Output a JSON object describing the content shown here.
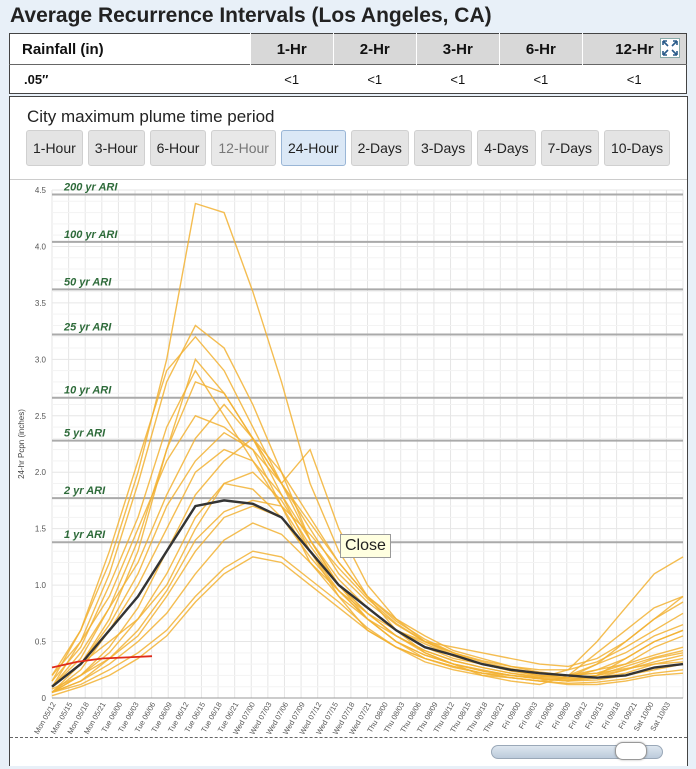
{
  "page_title": "Average Recurrence Intervals (Los Angeles, CA)",
  "ari_table": {
    "headers": [
      "Rainfall (in)",
      "1-Hr",
      "2-Hr",
      "3-Hr",
      "6-Hr",
      "12-Hr"
    ],
    "row": [
      ".05″",
      "<1",
      "<1",
      "<1",
      "<1",
      "<1"
    ],
    "expand_icon": "expand-arrows-icon"
  },
  "panel": {
    "title": "City maximum plume time period",
    "buttons": [
      {
        "label": "1-Hour",
        "state": "normal"
      },
      {
        "label": "3-Hour",
        "state": "normal"
      },
      {
        "label": "6-Hour",
        "state": "normal"
      },
      {
        "label": "12-Hour",
        "state": "disabled"
      },
      {
        "label": "24-Hour",
        "state": "active"
      },
      {
        "label": "2-Days",
        "state": "normal"
      },
      {
        "label": "3-Days",
        "state": "normal"
      },
      {
        "label": "4-Days",
        "state": "normal"
      },
      {
        "label": "7-Days",
        "state": "normal"
      },
      {
        "label": "10-Days",
        "state": "normal"
      }
    ],
    "tooltip": "Close"
  },
  "colors": {
    "ensemble": "#f2b233",
    "mean": "#333333",
    "observed": "#e02a1a",
    "ari_line": "#aaaaaa",
    "ari_label": "#2e6b3a",
    "active_button": "#dbe8f6"
  },
  "chart_data": {
    "type": "line",
    "ylabel": "24-hr Pcpn (inches)",
    "ylim": [
      0,
      4.5
    ],
    "yticks": [
      "0",
      "0.5",
      "1.0",
      "1.5",
      "2.0",
      "2.5",
      "3.0",
      "3.5",
      "4.0",
      "4.5"
    ],
    "x_ticks": [
      "Mon 05/12",
      "Mon 05/15",
      "Mon 05/18",
      "Mon 05/21",
      "Tue 06/00",
      "Tue 06/03",
      "Tue 06/06",
      "Tue 06/09",
      "Tue 06/12",
      "Tue 06/15",
      "Tue 06/18",
      "Tue 06/21",
      "Wed 07/00",
      "Wed 07/03",
      "Wed 07/06",
      "Wed 07/09",
      "Wed 07/12",
      "Wed 07/15",
      "Wed 07/18",
      "Wed 07/21",
      "Thu 08/00",
      "Thu 08/03",
      "Thu 08/06",
      "Thu 08/09",
      "Thu 08/12",
      "Thu 08/15",
      "Thu 08/18",
      "Thu 08/21",
      "Fri 09/00",
      "Fri 09/03",
      "Fri 09/06",
      "Fri 09/09",
      "Fri 09/12",
      "Fri 09/15",
      "Fri 09/18",
      "Fri 09/21",
      "Sat 10/00",
      "Sat 10/03"
    ],
    "ari_thresholds": [
      {
        "label": "200 yr ARI",
        "value": 4.46
      },
      {
        "label": "100 yr ARI",
        "value": 4.04
      },
      {
        "label": "50 yr ARI",
        "value": 3.62
      },
      {
        "label": "25 yr ARI",
        "value": 3.22
      },
      {
        "label": "10 yr ARI",
        "value": 2.66
      },
      {
        "label": "5 yr ARI",
        "value": 2.28
      },
      {
        "label": "2 yr ARI",
        "value": 1.77
      },
      {
        "label": "1 yr ARI",
        "value": 1.38
      }
    ],
    "series": [
      {
        "name": "",
        "role": "mean",
        "values": [
          0.1,
          0.3,
          0.6,
          0.9,
          1.3,
          1.7,
          1.75,
          1.72,
          1.6,
          1.3,
          1.0,
          0.8,
          0.6,
          0.45,
          0.38,
          0.3,
          0.25,
          0.22,
          0.2,
          0.18,
          0.2,
          0.27,
          0.3
        ]
      },
      {
        "name": "",
        "role": "observed",
        "values": [
          0.27,
          0.32,
          0.35,
          0.36,
          0.37
        ]
      },
      {
        "name": "",
        "role": "member",
        "values": [
          0.15,
          0.6,
          1.2,
          2.0,
          3.0,
          4.38,
          4.3,
          3.6,
          2.8,
          1.9,
          1.3,
          0.9,
          0.6,
          0.4,
          0.3,
          0.2,
          0.15,
          0.12,
          0.2,
          0.4,
          0.6,
          0.8,
          0.9
        ]
      },
      {
        "name": "",
        "role": "member",
        "values": [
          0.1,
          0.5,
          1.1,
          1.9,
          2.8,
          3.3,
          3.1,
          2.6,
          2.0,
          1.4,
          1.0,
          0.7,
          0.5,
          0.35,
          0.28,
          0.22,
          0.2,
          0.18,
          0.25,
          0.5,
          0.8,
          1.1,
          1.25
        ]
      },
      {
        "name": "",
        "role": "member",
        "values": [
          0.05,
          0.3,
          0.7,
          1.3,
          2.2,
          3.0,
          2.7,
          2.3,
          1.8,
          1.3,
          0.9,
          0.6,
          0.45,
          0.32,
          0.25,
          0.2,
          0.18,
          0.15,
          0.18,
          0.3,
          0.5,
          0.7,
          0.85
        ]
      },
      {
        "name": "",
        "role": "member",
        "values": [
          0.2,
          0.5,
          0.9,
          1.5,
          2.1,
          2.5,
          2.4,
          2.2,
          1.7,
          1.2,
          0.9,
          0.7,
          0.55,
          0.4,
          0.3,
          0.24,
          0.2,
          0.17,
          0.15,
          0.2,
          0.35,
          0.5,
          0.6
        ]
      },
      {
        "name": "",
        "role": "member",
        "values": [
          0.1,
          0.35,
          0.8,
          1.2,
          1.8,
          2.3,
          2.6,
          2.3,
          1.9,
          1.5,
          1.1,
          0.85,
          0.65,
          0.5,
          0.4,
          0.3,
          0.25,
          0.2,
          0.2,
          0.25,
          0.3,
          0.45,
          0.55
        ]
      },
      {
        "name": "",
        "role": "member",
        "values": [
          0.05,
          0.25,
          0.6,
          1.0,
          1.5,
          2.0,
          2.2,
          2.1,
          1.8,
          1.4,
          1.05,
          0.8,
          0.6,
          0.45,
          0.35,
          0.3,
          0.25,
          0.22,
          0.2,
          0.3,
          0.4,
          0.55,
          0.65
        ]
      },
      {
        "name": "",
        "role": "member",
        "values": [
          0.05,
          0.2,
          0.45,
          0.8,
          1.3,
          1.8,
          2.1,
          2.3,
          2.0,
          1.6,
          1.2,
          0.9,
          0.7,
          0.55,
          0.42,
          0.35,
          0.28,
          0.23,
          0.2,
          0.22,
          0.3,
          0.38,
          0.45
        ]
      },
      {
        "name": "",
        "role": "member",
        "values": [
          0.1,
          0.3,
          0.5,
          0.7,
          1.0,
          1.5,
          1.9,
          2.0,
          1.75,
          1.35,
          1.0,
          0.8,
          0.6,
          0.48,
          0.37,
          0.3,
          0.24,
          0.2,
          0.18,
          0.2,
          0.25,
          0.35,
          0.4
        ]
      },
      {
        "name": "",
        "role": "member",
        "values": [
          0.08,
          0.2,
          0.35,
          0.55,
          0.9,
          1.3,
          1.6,
          1.7,
          1.6,
          1.3,
          1.0,
          0.75,
          0.55,
          0.42,
          0.33,
          0.27,
          0.22,
          0.19,
          0.17,
          0.18,
          0.22,
          0.3,
          0.35
        ]
      },
      {
        "name": "",
        "role": "member",
        "values": [
          0.05,
          0.15,
          0.3,
          0.5,
          0.75,
          1.1,
          1.4,
          1.55,
          1.45,
          1.2,
          0.95,
          0.7,
          0.5,
          0.38,
          0.3,
          0.25,
          0.2,
          0.17,
          0.15,
          0.16,
          0.2,
          0.25,
          0.3
        ]
      },
      {
        "name": "",
        "role": "member",
        "values": [
          0.05,
          0.12,
          0.25,
          0.4,
          0.6,
          0.9,
          1.15,
          1.3,
          1.25,
          1.05,
          0.85,
          0.62,
          0.45,
          0.35,
          0.27,
          0.22,
          0.18,
          0.15,
          0.13,
          0.14,
          0.17,
          0.22,
          0.25
        ]
      },
      {
        "name": "",
        "role": "member",
        "values": [
          0.15,
          0.45,
          1.0,
          1.6,
          2.4,
          2.9,
          2.5,
          2.1,
          1.7,
          1.3,
          0.95,
          0.7,
          0.5,
          0.38,
          0.3,
          0.24,
          0.2,
          0.17,
          0.15,
          0.18,
          0.25,
          0.32,
          0.38
        ]
      },
      {
        "name": "",
        "role": "member",
        "values": [
          0.1,
          0.4,
          0.8,
          1.4,
          2.2,
          2.8,
          2.7,
          2.3,
          1.9,
          2.2,
          1.5,
          1.0,
          0.7,
          0.5,
          0.38,
          0.3,
          0.24,
          0.2,
          0.18,
          0.25,
          0.35,
          0.5,
          0.6
        ]
      },
      {
        "name": "",
        "role": "member",
        "values": [
          0.05,
          0.2,
          0.4,
          0.7,
          1.1,
          1.6,
          1.9,
          1.85,
          1.6,
          1.25,
          0.95,
          0.75,
          0.6,
          0.5,
          0.45,
          0.4,
          0.35,
          0.3,
          0.28,
          0.35,
          0.5,
          0.7,
          0.9
        ]
      },
      {
        "name": "",
        "role": "member",
        "values": [
          0.02,
          0.1,
          0.2,
          0.35,
          0.55,
          0.85,
          1.1,
          1.25,
          1.2,
          1.0,
          0.8,
          0.6,
          0.45,
          0.35,
          0.28,
          0.22,
          0.18,
          0.15,
          0.12,
          0.12,
          0.15,
          0.2,
          0.22
        ]
      },
      {
        "name": "",
        "role": "member",
        "values": [
          0.2,
          0.6,
          1.3,
          2.1,
          2.9,
          3.2,
          2.9,
          2.4,
          1.9,
          1.4,
          1.0,
          0.75,
          0.55,
          0.42,
          0.33,
          0.27,
          0.22,
          0.18,
          0.16,
          0.2,
          0.28,
          0.36,
          0.42
        ]
      },
      {
        "name": "",
        "role": "member",
        "values": [
          0.1,
          0.3,
          0.65,
          1.1,
          1.7,
          2.1,
          2.35,
          2.2,
          1.9,
          1.55,
          1.2,
          0.9,
          0.68,
          0.52,
          0.4,
          0.32,
          0.26,
          0.22,
          0.2,
          0.22,
          0.26,
          0.3,
          0.32
        ]
      },
      {
        "name": "",
        "role": "member",
        "values": [
          0.05,
          0.15,
          0.35,
          0.6,
          0.95,
          1.4,
          1.65,
          1.75,
          1.7,
          1.45,
          1.15,
          0.88,
          0.66,
          0.5,
          0.4,
          0.33,
          0.28,
          0.25,
          0.25,
          0.32,
          0.45,
          0.6,
          0.75
        ]
      }
    ]
  }
}
